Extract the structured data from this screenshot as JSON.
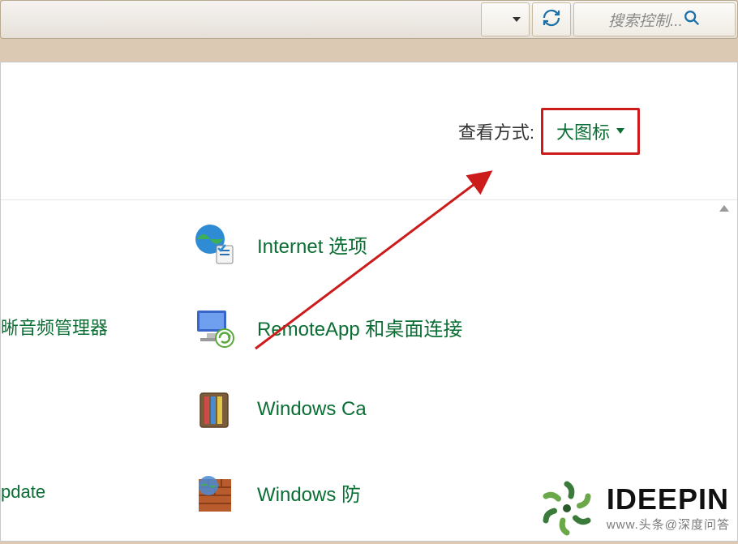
{
  "toolbar": {
    "search_placeholder": "搜索控制..."
  },
  "view_header": {
    "label": "查看方式:",
    "selected": "大图标"
  },
  "items": [
    {
      "left_fragment": "",
      "label": "Internet 选项"
    },
    {
      "left_fragment": "晰音频管理器",
      "label": "RemoteApp 和桌面连接"
    },
    {
      "left_fragment": "",
      "label": "Windows Ca"
    },
    {
      "left_fragment": "pdate",
      "label": "Windows 防"
    }
  ],
  "watermark": {
    "brand": "IDEEPIN",
    "subtext": "www.头条@深度问答"
  },
  "colors": {
    "accent_green": "#0b6e34",
    "annotation_red": "#cc1b1b",
    "link_blue": "#1b6fa8"
  }
}
